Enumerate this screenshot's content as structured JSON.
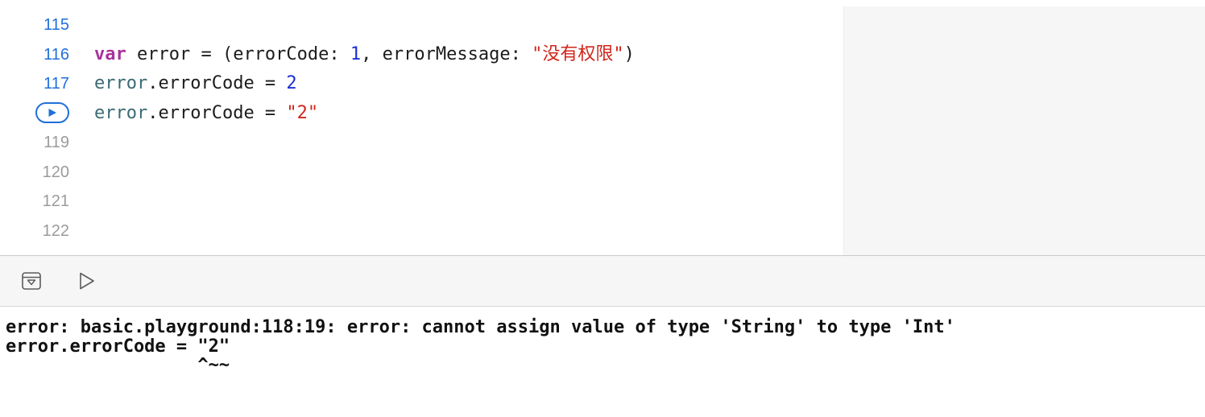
{
  "editor": {
    "lines": [
      {
        "number": "115",
        "active": true,
        "segments": []
      },
      {
        "number": "116",
        "active": true,
        "segments": [
          {
            "cls": "kw",
            "text": "var"
          },
          {
            "cls": "plain",
            "text": " error = (errorCode: "
          },
          {
            "cls": "num-lit",
            "text": "1"
          },
          {
            "cls": "plain",
            "text": ", errorMessage: "
          },
          {
            "cls": "str-lit",
            "text": "\"没有权限\""
          },
          {
            "cls": "plain",
            "text": ")"
          }
        ]
      },
      {
        "number": "117",
        "active": true,
        "segments": [
          {
            "cls": "var-name",
            "text": "error"
          },
          {
            "cls": "plain",
            "text": ".errorCode = "
          },
          {
            "cls": "num-lit",
            "text": "2"
          }
        ]
      },
      {
        "number": "",
        "active": true,
        "run_marker": true,
        "segments": [
          {
            "cls": "var-name",
            "text": "error"
          },
          {
            "cls": "plain",
            "text": ".errorCode = "
          },
          {
            "cls": "str-lit",
            "text": "\"2\""
          }
        ]
      },
      {
        "number": "119",
        "active": false,
        "segments": []
      },
      {
        "number": "120",
        "active": false,
        "segments": []
      },
      {
        "number": "121",
        "active": false,
        "segments": []
      },
      {
        "number": "122",
        "active": false,
        "segments": []
      }
    ],
    "run_marker_icon": "play-circle-icon"
  },
  "toolbar": {
    "hide_debug_icon": "hide-debug-area-icon",
    "run_icon": "play-icon"
  },
  "console": {
    "lines": [
      "error: basic.playground:118:19: error: cannot assign value of type 'String' to type 'Int'",
      "error.errorCode = \"2\"",
      "                  ^~~"
    ]
  },
  "colors": {
    "accent": "#1f6fdb",
    "keyword": "#a8329d",
    "string": "#d0251a",
    "number": "#1c2fd6",
    "identifier": "#3a6a73"
  }
}
